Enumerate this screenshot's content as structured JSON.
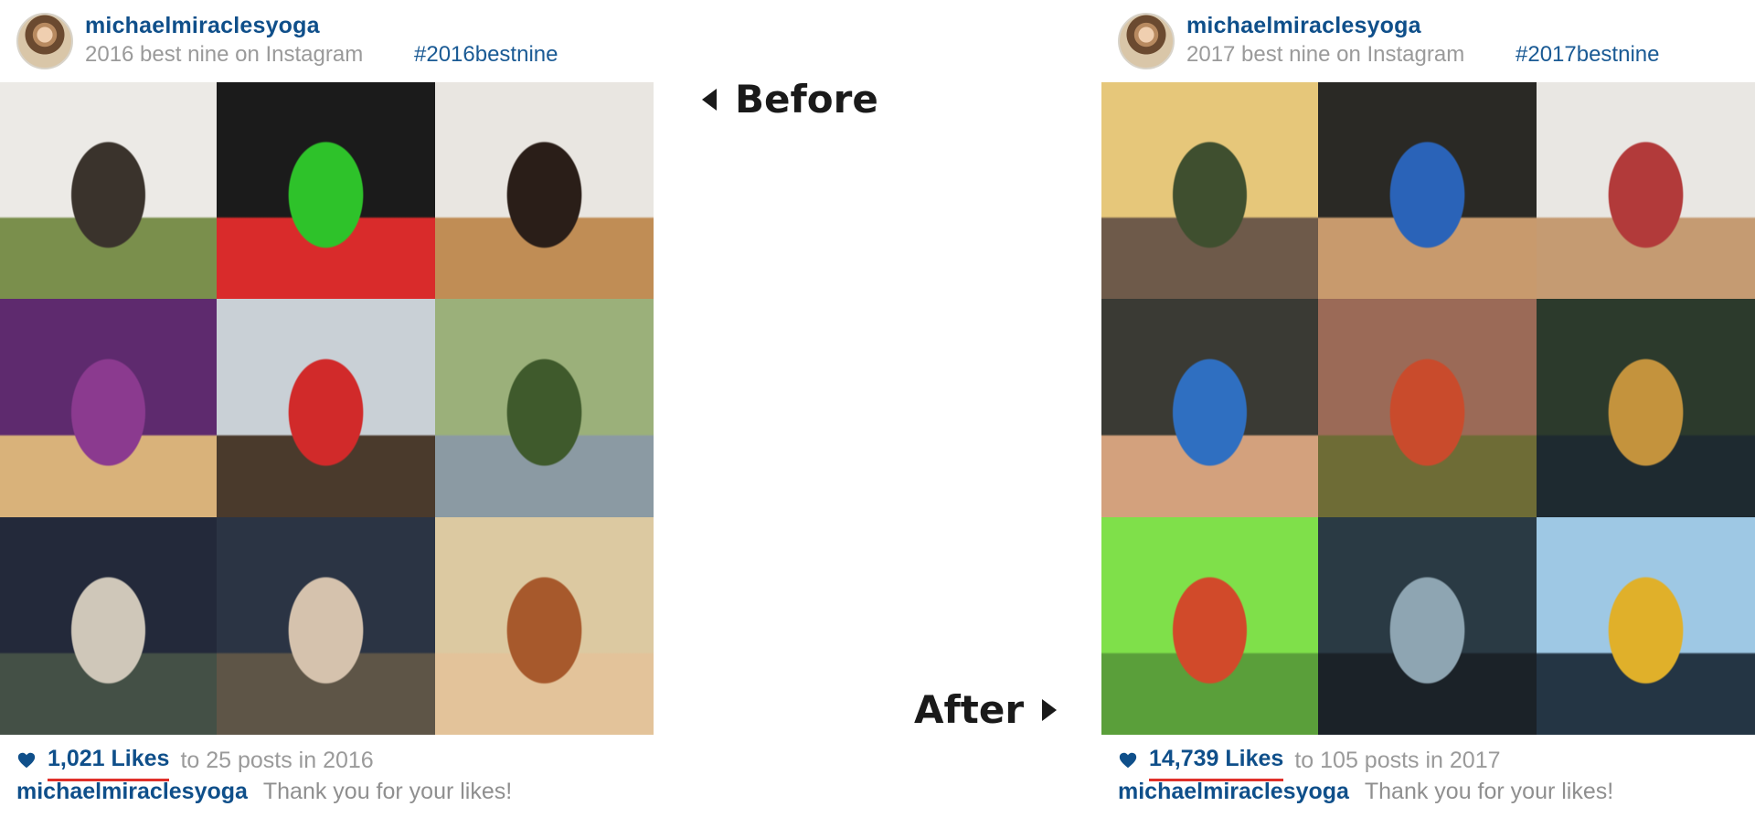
{
  "before_label": "Before",
  "after_label": "After",
  "panels": [
    {
      "username": "michaelmiraclesyoga",
      "subtitle": "2016 best nine on Instagram",
      "hashtag": "#2016bestnine",
      "likes": "1,021 Likes",
      "likes_rest": "to 25 posts in 2016",
      "caption_user": "michaelmiraclesyoga",
      "caption_text": "Thank you for your likes!",
      "tile_colors": [
        [
          "#eceae6",
          "#3a332c",
          "#7a8f4c"
        ],
        [
          "#1b1b1b",
          "#2ec22a",
          "#d92b2b"
        ],
        [
          "#e9e6e1",
          "#2a1e18",
          "#c08d55"
        ],
        [
          "#5e2a6e",
          "#8b3a8f",
          "#d9b27a"
        ],
        [
          "#c9d0d6",
          "#d12a2a",
          "#4a3a2c"
        ],
        [
          "#9bb07a",
          "#3f5a2c",
          "#8b9aa3"
        ],
        [
          "#23293a",
          "#cfc7b9",
          "#445046"
        ],
        [
          "#2b3444",
          "#d5c2ad",
          "#5e5547"
        ],
        [
          "#dcc9a1",
          "#a7592c",
          "#e3c39a"
        ]
      ]
    },
    {
      "username": "michaelmiraclesyoga",
      "subtitle": "2017 best nine on Instagram",
      "hashtag": "#2017bestnine",
      "likes": "14,739 Likes",
      "likes_rest": "to 105 posts in 2017",
      "caption_user": "michaelmiraclesyoga",
      "caption_text": "Thank you for your likes!",
      "tile_colors": [
        [
          "#e6c77a",
          "#3f4f2f",
          "#6e5a4a"
        ],
        [
          "#2a2925",
          "#2a63b8",
          "#c89a6d"
        ],
        [
          "#e9e7e3",
          "#b23a3a",
          "#c59b72"
        ],
        [
          "#3a3a34",
          "#2f6fc1",
          "#d3a17d"
        ],
        [
          "#9b6a57",
          "#c94b2c",
          "#6e6c36"
        ],
        [
          "#2c3a2c",
          "#c4933d",
          "#1e2a30"
        ],
        [
          "#7fe04a",
          "#d14a2a",
          "#5a9f3a"
        ],
        [
          "#2a3a44",
          "#8ea5b2",
          "#1b2228"
        ],
        [
          "#9ec8e4",
          "#e0b02a",
          "#243544"
        ]
      ]
    }
  ]
}
